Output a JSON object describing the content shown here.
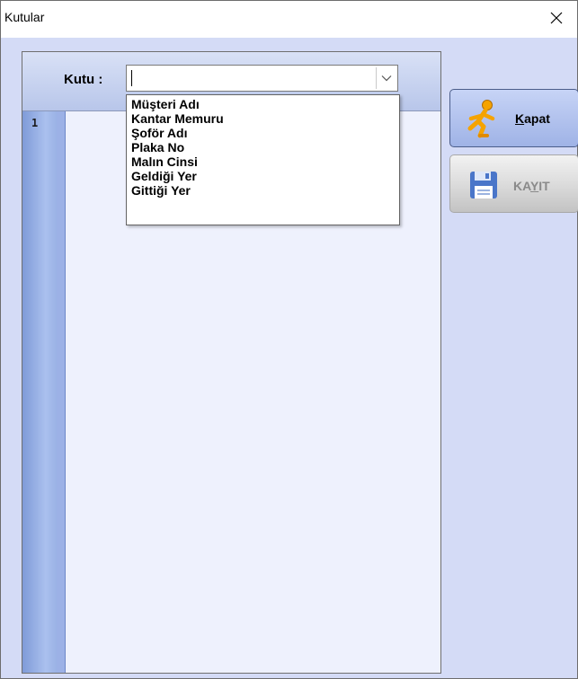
{
  "window": {
    "title": "Kutular"
  },
  "header": {
    "kutu_label": "Kutu :",
    "combo_value": ""
  },
  "dropdown": {
    "items": [
      "Müşteri Adı",
      "Kantar Memuru",
      "Şoför Adı",
      "Plaka No",
      "Malın Cinsi",
      "Geldiği Yer",
      "Gittiği Yer"
    ]
  },
  "editor": {
    "line_number": "1"
  },
  "buttons": {
    "kapat_accel": "K",
    "kapat_rest": "apat",
    "kayit_first": "KA",
    "kayit_accel": "Y",
    "kayit_rest": "IT"
  },
  "colors": {
    "client_bg": "#d4dbf6",
    "panel_bg": "#eef1fd",
    "gutter": "#8fa8df",
    "kapat_icon": "#f5a300",
    "kayit_icon": "#4a76c9"
  },
  "icons": {
    "close": "close-icon",
    "dropdown": "chevron-down-icon",
    "kapat": "running-person-icon",
    "kayit": "floppy-disk-icon"
  }
}
